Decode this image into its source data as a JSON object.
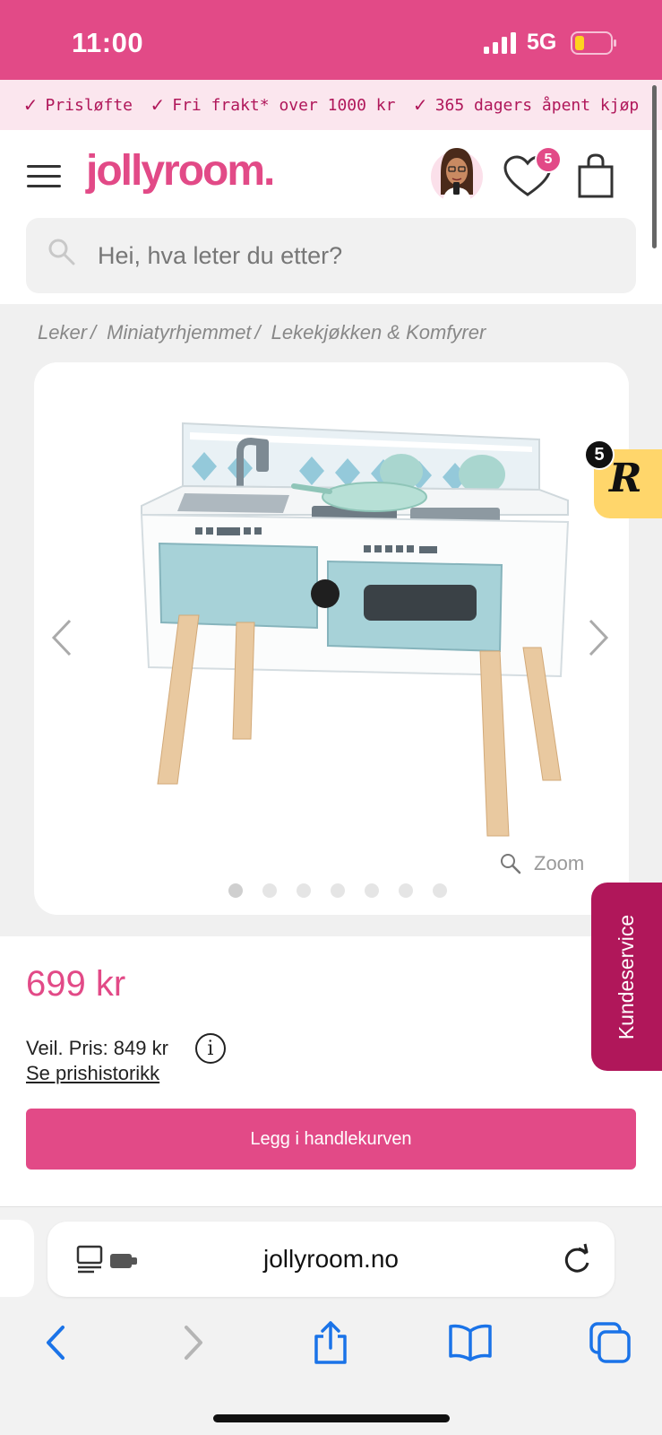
{
  "status_bar": {
    "time": "11:00",
    "network": "5G"
  },
  "benefits": [
    {
      "label": "Prisløfte"
    },
    {
      "label": "Fri frakt* over 1000 kr"
    },
    {
      "label": "365 dagers åpent kjøp"
    }
  ],
  "header": {
    "logo": "jollyroom.",
    "wishlist_count": "5"
  },
  "search": {
    "placeholder": "Hei, hva leter du etter?"
  },
  "breadcrumb": [
    {
      "label": "Leker"
    },
    {
      "label": "Miniatyrhjemmet"
    },
    {
      "label": "Lekekjøkken & Komfyrer"
    }
  ],
  "gallery": {
    "zoom_label": "Zoom",
    "image_count": 7,
    "active_index": 0
  },
  "reviews_badge": {
    "count": "5",
    "letter": "R"
  },
  "customer_service": {
    "label": "Kundeservice"
  },
  "product": {
    "price": "699 kr",
    "rrp": "Veil. Pris: 849 kr",
    "info_icon": "i",
    "price_history_link": "Se prishistorikk",
    "add_to_cart_label": "Legg i handlekurven"
  },
  "browser": {
    "url": "jollyroom.no"
  },
  "colors": {
    "brand": "#e24a87",
    "brand_dark": "#b0175a",
    "benefit_bg": "#fbe6ee",
    "ios_blue": "#1a73e8"
  }
}
